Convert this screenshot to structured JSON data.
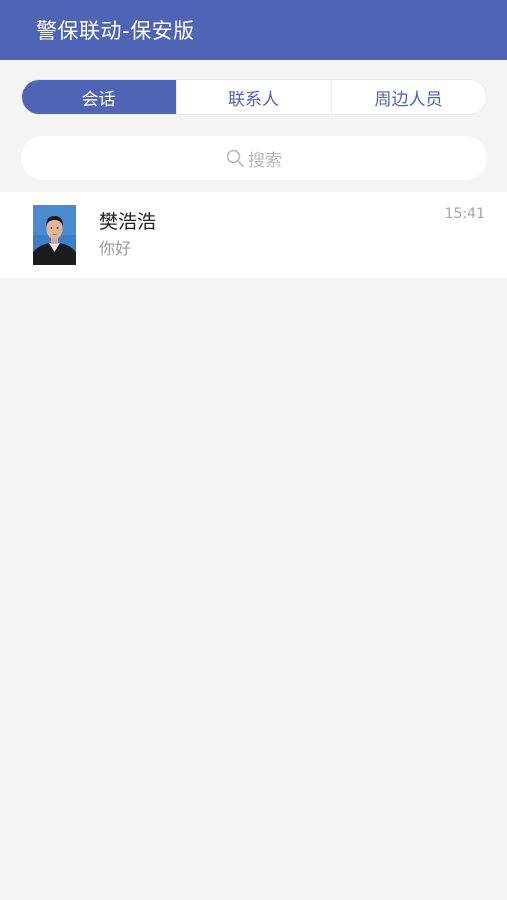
{
  "header": {
    "title": "警保联动-保安版"
  },
  "tabs": [
    {
      "label": "会话",
      "active": true
    },
    {
      "label": "联系人",
      "active": false
    },
    {
      "label": "周边人员",
      "active": false
    }
  ],
  "search": {
    "placeholder": "搜索"
  },
  "conversations": [
    {
      "name": "樊浩浩",
      "last_message": "你好",
      "time": "15:41",
      "avatar": "user-photo"
    }
  ],
  "colors": {
    "accent": "#4f64b4",
    "background": "#f4f4f4"
  }
}
